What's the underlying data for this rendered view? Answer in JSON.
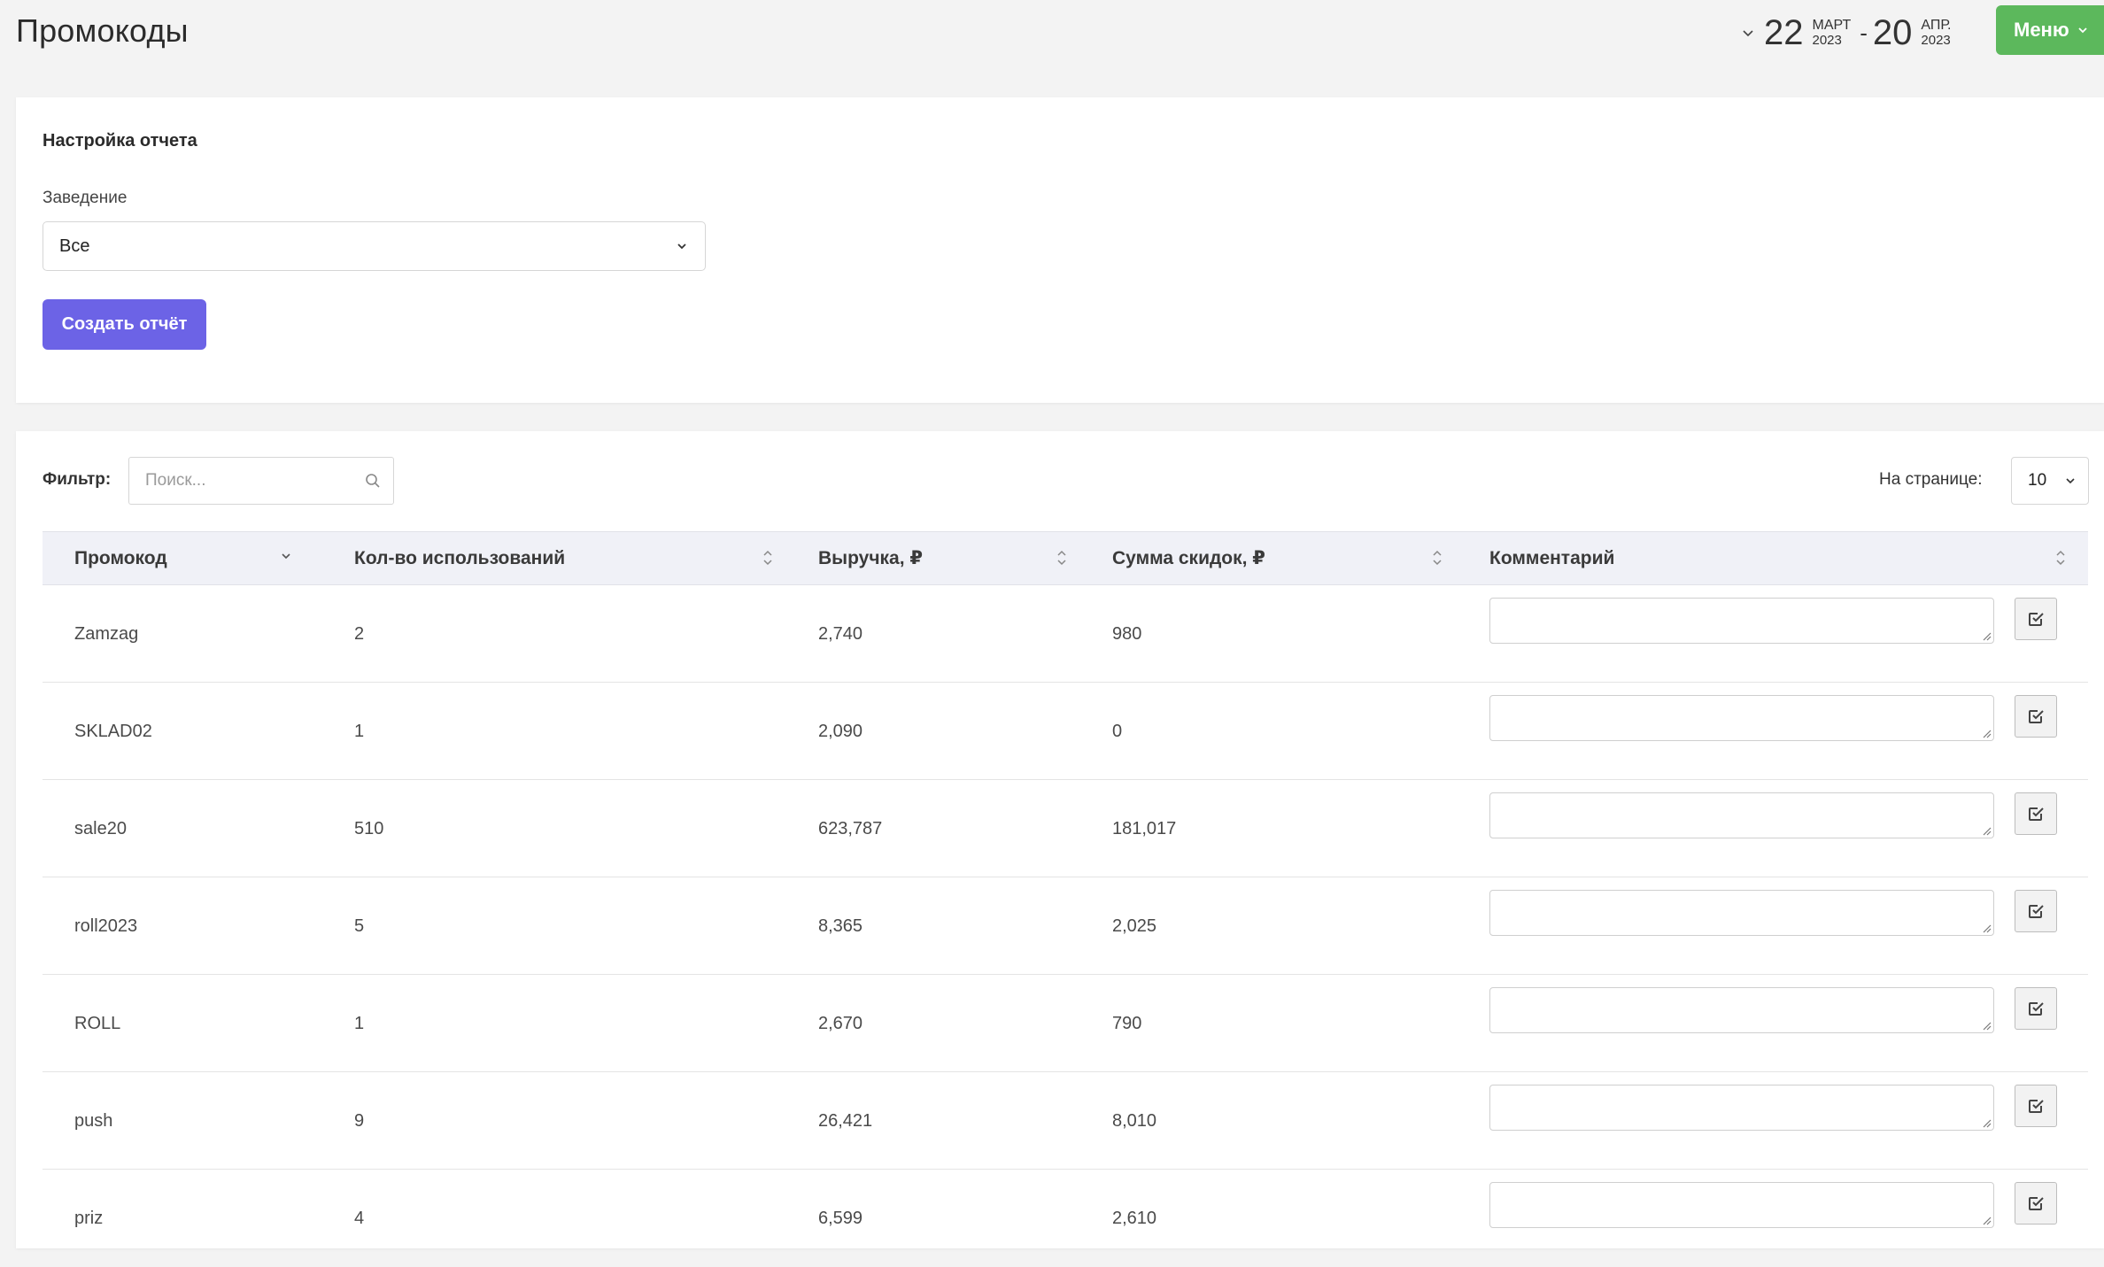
{
  "header": {
    "title": "Промокоды",
    "date_from": {
      "day": "22",
      "month": "МАРТ",
      "year": "2023"
    },
    "date_separator": "-",
    "date_to": {
      "day": "20",
      "month": "АПР.",
      "year": "2023"
    },
    "menu_label": "Меню",
    "menu_color": "#5cb85c"
  },
  "settings": {
    "title": "Настройка отчета",
    "venue_label": "Заведение",
    "venue_value": "Все",
    "create_button": "Создать отчёт",
    "create_button_color": "#6c63e6"
  },
  "table": {
    "filter_label": "Фильтр:",
    "search_placeholder": "Поиск...",
    "per_page_label": "На странице:",
    "per_page_value": "10",
    "columns": [
      "Промокод",
      "Кол-во использований",
      "Выручка, ₽",
      "Сумма скидок, ₽",
      "Комментарий"
    ],
    "rows": [
      {
        "code": "Zamzag",
        "uses": "2",
        "revenue": "2,740",
        "discounts": "980",
        "comment": ""
      },
      {
        "code": "SKLAD02",
        "uses": "1",
        "revenue": "2,090",
        "discounts": "0",
        "comment": ""
      },
      {
        "code": "sale20",
        "uses": "510",
        "revenue": "623,787",
        "discounts": "181,017",
        "comment": ""
      },
      {
        "code": "roll2023",
        "uses": "5",
        "revenue": "8,365",
        "discounts": "2,025",
        "comment": ""
      },
      {
        "code": "ROLL",
        "uses": "1",
        "revenue": "2,670",
        "discounts": "790",
        "comment": ""
      },
      {
        "code": "push",
        "uses": "9",
        "revenue": "26,421",
        "discounts": "8,010",
        "comment": ""
      },
      {
        "code": "priz",
        "uses": "4",
        "revenue": "6,599",
        "discounts": "2,610",
        "comment": ""
      }
    ]
  },
  "icons": {
    "date_chevron": "chevron-down-icon",
    "menu_chevron": "chevron-down-icon",
    "select_chevron": "chevron-down-icon",
    "search": "search-icon",
    "sort": "sort-icon",
    "save": "check-square-icon",
    "resize": "resize-grip-icon"
  }
}
